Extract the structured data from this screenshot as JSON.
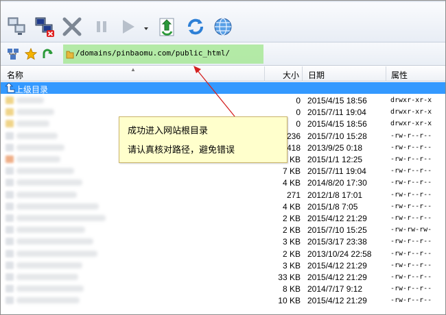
{
  "toolbar": {
    "buttons": [
      {
        "icon": "connect-icon"
      },
      {
        "icon": "disconnect-icon"
      },
      {
        "icon": "delete-icon"
      },
      {
        "icon": "pause-icon"
      },
      {
        "icon": "play-icon"
      },
      {
        "icon": "download-refresh-icon"
      },
      {
        "icon": "refresh-icon"
      },
      {
        "icon": "globe-icon"
      }
    ]
  },
  "address": {
    "path": "/domains/pinbaomu.com/public_html/"
  },
  "columns": {
    "name": "名称",
    "size": "大小",
    "date": "日期",
    "perm": "属性"
  },
  "parent_row": {
    "label": "上级目录"
  },
  "rows": [
    {
      "size": "0",
      "date": "2015/4/15 18:56",
      "perm": "drwxr-xr-x"
    },
    {
      "size": "0",
      "date": "2015/7/11 19:04",
      "perm": "drwxr-xr-x"
    },
    {
      "size": "0",
      "date": "2015/4/15 18:56",
      "perm": "drwxr-xr-x"
    },
    {
      "size": "236",
      "date": "2015/7/10 15:28",
      "perm": "-rw-r--r--"
    },
    {
      "size": "418",
      "date": "2013/9/25 0:18",
      "perm": "-rw-r--r--"
    },
    {
      "size": "KB",
      "date": "2015/1/1 12:25",
      "perm": "-rw-r--r--"
    },
    {
      "size": "7 KB",
      "date": "2015/7/11 19:04",
      "perm": "-rw-r--r--"
    },
    {
      "size": "4 KB",
      "date": "2014/8/20 17:30",
      "perm": "-rw-r--r--"
    },
    {
      "size": "271",
      "date": "2012/1/8 17:01",
      "perm": "-rw-r--r--"
    },
    {
      "size": "4 KB",
      "date": "2015/1/8 7:05",
      "perm": "-rw-r--r--"
    },
    {
      "size": "2 KB",
      "date": "2015/4/12 21:29",
      "perm": "-rw-r--r--"
    },
    {
      "size": "2 KB",
      "date": "2015/7/10 15:25",
      "perm": "-rw-rw-rw-"
    },
    {
      "size": "3 KB",
      "date": "2015/3/17 23:38",
      "perm": "-rw-r--r--"
    },
    {
      "size": "2 KB",
      "date": "2013/10/24 22:58",
      "perm": "-rw-r--r--"
    },
    {
      "size": "3 KB",
      "date": "2015/4/12 21:29",
      "perm": "-rw-r--r--"
    },
    {
      "size": "33 KB",
      "date": "2015/4/12 21:29",
      "perm": "-rw-r--r--"
    },
    {
      "size": "8 KB",
      "date": "2014/7/17 9:12",
      "perm": "-rw-r--r--"
    },
    {
      "size": "10 KB",
      "date": "2015/4/12 21:29",
      "perm": "-rw-r--r--"
    }
  ],
  "callout": {
    "line1": "成功进入网站根目录",
    "line2": "请认真核对路径，避免错误"
  },
  "colors": {
    "selection": "#3399ff",
    "highlight_green": "#a8e898",
    "callout_bg": "#ffffcc",
    "arrow_red": "#d42020"
  }
}
